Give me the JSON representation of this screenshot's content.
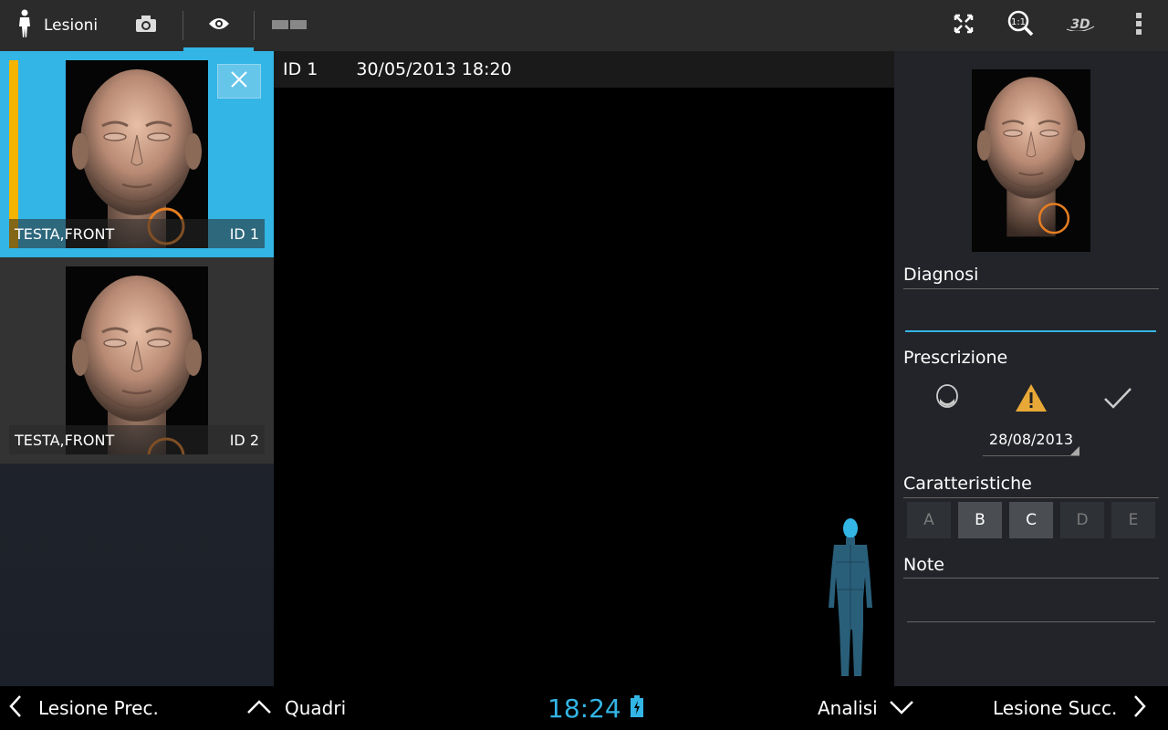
{
  "topbar": {
    "lesioni_label": "Lesioni",
    "icons": [
      "person-icon",
      "camera-icon",
      "eye-icon",
      "compare-icon",
      "fullscreen-icon",
      "zoom-1to1-icon",
      "3d-icon",
      "overflow-menu-icon"
    ],
    "accent_color": "#33b5e5"
  },
  "lesions": [
    {
      "region": "TESTA,FRONT",
      "id": "ID 1",
      "selected": true
    },
    {
      "region": "TESTA,FRONT",
      "id": "ID 2",
      "selected": false
    }
  ],
  "viewer": {
    "id": "ID 1",
    "datetime": "30/05/2013 18:20"
  },
  "details": {
    "diagnosi_label": "Diagnosi",
    "diagnosi_value": "",
    "prescrizione_label": "Prescrizione",
    "prescrizione_date": "28/08/2013",
    "caratteristiche_label": "Caratteristiche",
    "caratteristiche": [
      {
        "label": "A",
        "active": false
      },
      {
        "label": "B",
        "active": true
      },
      {
        "label": "C",
        "active": true
      },
      {
        "label": "D",
        "active": false
      },
      {
        "label": "E",
        "active": false
      }
    ],
    "note_label": "Note"
  },
  "bottombar": {
    "prev_label": "Lesione Prec.",
    "quadri_label": "Quadri",
    "clock": "18:24",
    "analisi_label": "Analisi",
    "next_label": "Lesione Succ."
  },
  "colors": {
    "selection": "#33b5e5",
    "marker": "#e67e22",
    "warning": "#e8a838"
  }
}
